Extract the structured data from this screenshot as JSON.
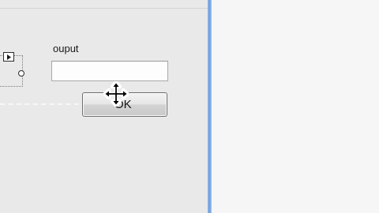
{
  "form": {
    "output_label": "ouput",
    "output_value": "",
    "ok_label": "OK"
  },
  "icons": {
    "play": "play-icon",
    "node": "node-icon",
    "cursor": "move-cursor-icon"
  },
  "colors": {
    "form_background": "#e9e9e9",
    "window_border": "#6f9fe0",
    "right_pane": "#f6f6f6"
  }
}
